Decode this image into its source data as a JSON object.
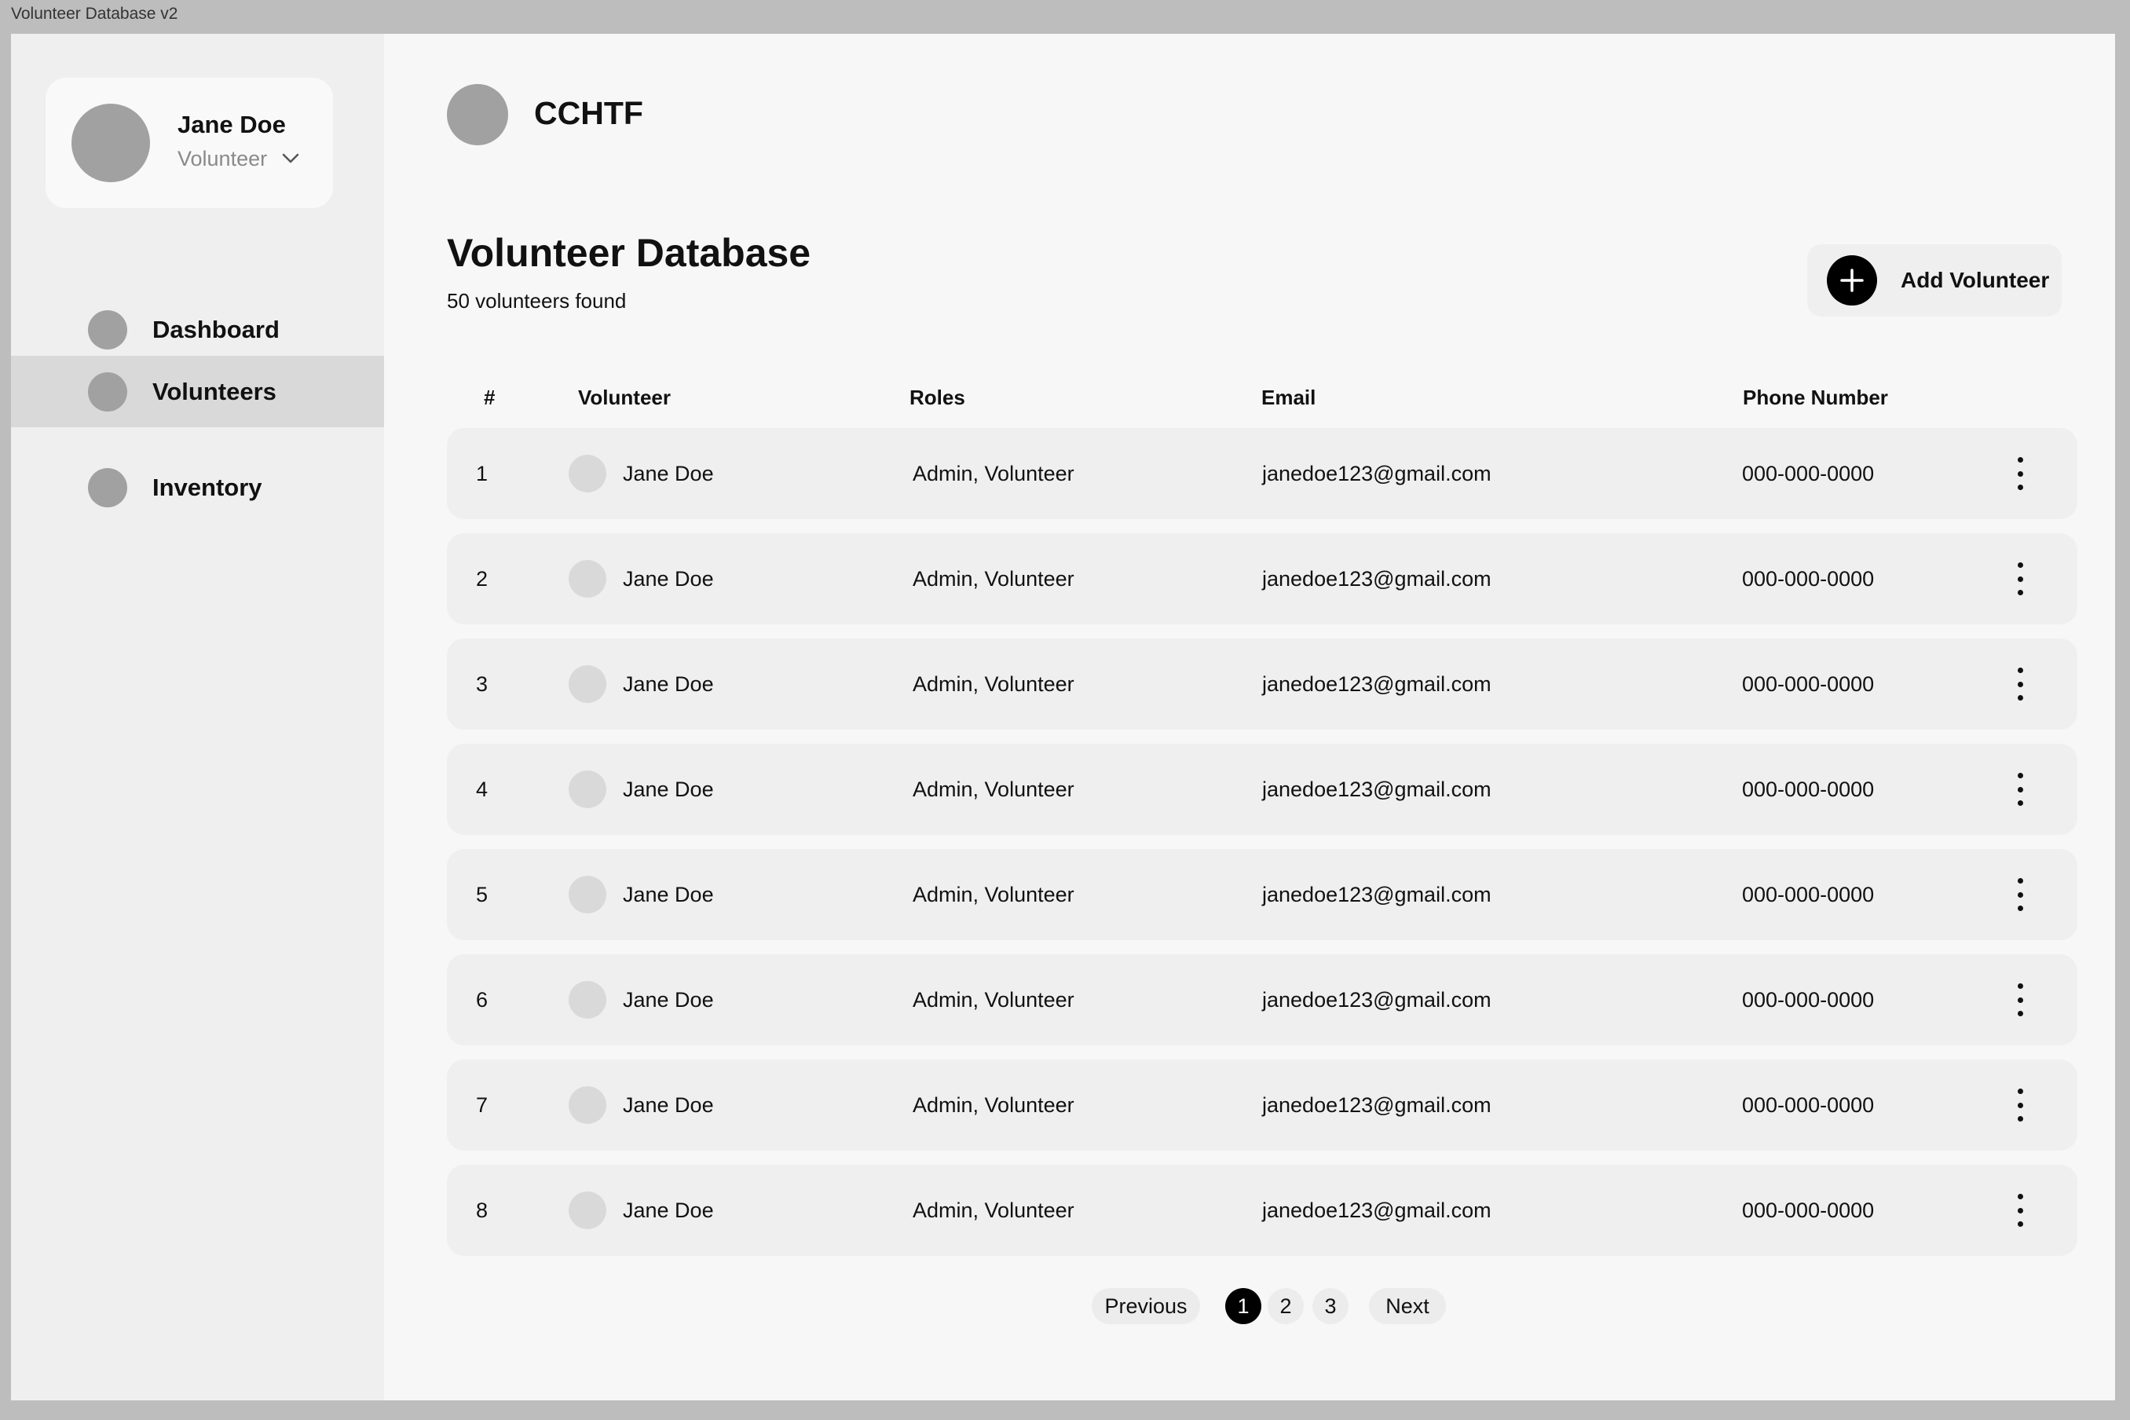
{
  "window": {
    "title": "Volunteer Database v2"
  },
  "sidebar": {
    "profile": {
      "name": "Jane Doe",
      "role": "Volunteer"
    },
    "items": [
      {
        "label": "Dashboard",
        "icon": "circle-icon",
        "active": false
      },
      {
        "label": "Volunteers",
        "icon": "circle-icon",
        "active": true
      },
      {
        "label": "Inventory",
        "icon": "circle-icon",
        "active": false
      }
    ]
  },
  "header": {
    "org_name": "CCHTF"
  },
  "main": {
    "title": "Volunteer Database",
    "count_text": "50 volunteers found",
    "add_button_label": "Add Volunteer"
  },
  "table": {
    "columns": [
      "#",
      "Volunteer",
      "Roles",
      "Email",
      "Phone Number"
    ],
    "rows": [
      {
        "num": "1",
        "name": "Jane Doe",
        "roles": "Admin, Volunteer",
        "email": "janedoe123@gmail.com",
        "phone": "000-000-0000"
      },
      {
        "num": "2",
        "name": "Jane Doe",
        "roles": "Admin, Volunteer",
        "email": "janedoe123@gmail.com",
        "phone": "000-000-0000"
      },
      {
        "num": "3",
        "name": "Jane Doe",
        "roles": "Admin, Volunteer",
        "email": "janedoe123@gmail.com",
        "phone": "000-000-0000"
      },
      {
        "num": "4",
        "name": "Jane Doe",
        "roles": "Admin, Volunteer",
        "email": "janedoe123@gmail.com",
        "phone": "000-000-0000"
      },
      {
        "num": "5",
        "name": "Jane Doe",
        "roles": "Admin, Volunteer",
        "email": "janedoe123@gmail.com",
        "phone": "000-000-0000"
      },
      {
        "num": "6",
        "name": "Jane Doe",
        "roles": "Admin, Volunteer",
        "email": "janedoe123@gmail.com",
        "phone": "000-000-0000"
      },
      {
        "num": "7",
        "name": "Jane Doe",
        "roles": "Admin, Volunteer",
        "email": "janedoe123@gmail.com",
        "phone": "000-000-0000"
      },
      {
        "num": "8",
        "name": "Jane Doe",
        "roles": "Admin, Volunteer",
        "email": "janedoe123@gmail.com",
        "phone": "000-000-0000"
      }
    ]
  },
  "pagination": {
    "previous_label": "Previous",
    "pages": [
      "1",
      "2",
      "3"
    ],
    "current_page": "1",
    "next_label": "Next"
  },
  "colors": {
    "active_nav": "#d9d9d9",
    "primary_button": "#000000",
    "placeholder_gray": "#a1a1a1"
  }
}
